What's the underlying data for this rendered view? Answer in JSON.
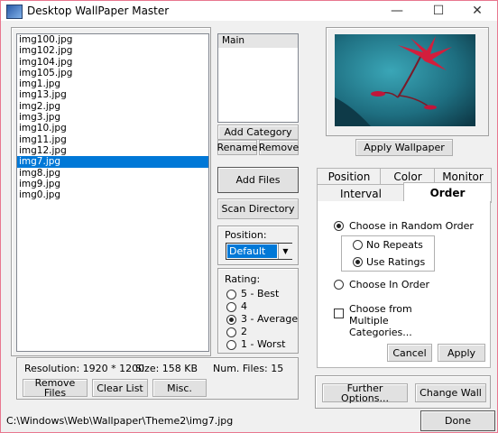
{
  "window": {
    "title": "Desktop WallPaper Master",
    "minimize_glyph": "—",
    "maximize_glyph": "☐",
    "close_glyph": "✕"
  },
  "files": {
    "items": [
      "img100.jpg",
      "img102.jpg",
      "img104.jpg",
      "img105.jpg",
      "img1.jpg",
      "img13.jpg",
      "img2.jpg",
      "img3.jpg",
      "img10.jpg",
      "img11.jpg",
      "img12.jpg",
      "img7.jpg",
      "img8.jpg",
      "img9.jpg",
      "img0.jpg"
    ],
    "selected_index": 11
  },
  "info": {
    "resolution": "Resolution: 1920 * 1200",
    "size": "Size: 158 KB",
    "num_files": "Num. Files: 15"
  },
  "buttons": {
    "remove_files": "Remove Files",
    "clear_list": "Clear List",
    "misc": "Misc.",
    "add_category": "Add Category",
    "rename": "Rename",
    "remove": "Remove",
    "add_files": "Add Files",
    "scan_directory": "Scan Directory",
    "apply_wallpaper": "Apply Wallpaper",
    "cancel": "Cancel",
    "apply": "Apply",
    "further_options": "Further Options...",
    "change_wall": "Change Wall",
    "done": "Done"
  },
  "categories": {
    "items": [
      "Main"
    ],
    "selected_index": 0
  },
  "position": {
    "label": "Position:",
    "value": "Default"
  },
  "rating": {
    "label": "Rating:",
    "options": [
      "5 - Best",
      "4",
      "3 - Average",
      "2",
      "1 - Worst"
    ],
    "selected_index": 2
  },
  "tabs": {
    "row1": [
      "Position",
      "Color",
      "Monitor"
    ],
    "row2": [
      "Interval",
      "Order"
    ],
    "active": "Order"
  },
  "order": {
    "random": "Choose in Random Order",
    "no_repeats": "No Repeats",
    "use_ratings": "Use Ratings",
    "in_order": "Choose In Order",
    "multiple_categories": "Choose from Multiple Categories...",
    "random_selected": true,
    "sub_selected": "use_ratings",
    "multiple_checked": false
  },
  "status": {
    "path": "C:\\Windows\\Web\\Wallpaper\\Theme2\\img7.jpg"
  },
  "colors": {
    "window_border": "#e8778f",
    "selection": "#0078d7",
    "preview_bg": "#1e6e80",
    "flower": "#d21e3c"
  }
}
